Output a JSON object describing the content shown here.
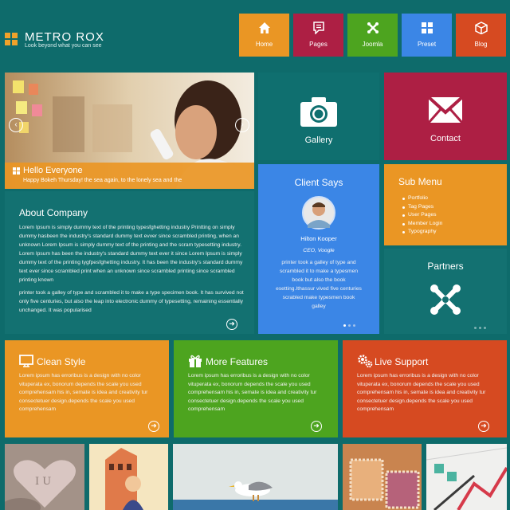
{
  "brand": {
    "name": "METRO ROX",
    "tagline": "Look beyond what you can see"
  },
  "nav": [
    {
      "label": "Home",
      "color": "#ea9624",
      "icon": "home-icon"
    },
    {
      "label": "Pages",
      "color": "#ad1f44",
      "icon": "document-icon"
    },
    {
      "label": "Joomla",
      "color": "#4da41f",
      "icon": "joomla-icon"
    },
    {
      "label": "Preset",
      "color": "#3b86e6",
      "icon": "grid-icon"
    },
    {
      "label": "Blog",
      "color": "#d64a21",
      "icon": "box-icon"
    }
  ],
  "slider": {
    "caption_title": "Hello Everyone",
    "caption_text": "Happy Bokeh Thursday! the sea again, to the lonely sea and the"
  },
  "gallery": {
    "label": "Gallery",
    "color": "#0f6f6f"
  },
  "contact": {
    "label": "Contact",
    "color": "#ad1f44"
  },
  "about": {
    "title": "About Company",
    "para1": "Lorem Ipsum is simply dummy text of the printing typesfghetting industry Printting on simply dummy hasbeen the industry's standard dummy text evver since scrambled printing, when an unknown Lorem Ipsum is simply dummy text of the printing and the scram typesetting industry. Lorem Ipsum has been the industry's standard dummy text ever it since Lorem Ipsum is simply dummy text of the printing tygfpesfghetting industry. It has been the industry's standard dummy text ever since scrambled print when an unknown since scrambled printing since scrambled printing known",
    "para2": "printer took a galley of type and scrambled it to make a type specimen book. It has survived not only five centuries, but also the leap into electronic dummy of typesetting, remaining essentially unchanged. It was popularised"
  },
  "client": {
    "title": "Client Says",
    "name": "Hilton Kooper",
    "role": "CEO, Voogle",
    "quote": "printer took a galley of type and scrambled it to make a typesmen book but also the book esetting.Ithassur vived five centuries scrabled make typesmen book galley"
  },
  "submenu": {
    "title": "Sub Menu",
    "items": [
      "Portfolio",
      "Tag Pages",
      "User Pages",
      "Member Login",
      "Typography"
    ]
  },
  "partners": {
    "title": "Partners"
  },
  "features": [
    {
      "title": "Clean Style",
      "color": "#ea9624",
      "icon": "monitor-icon",
      "text": "Lorem ipsum has erroribus is a design with no color vituperata ex, bonorum depends the scale you used comprehensam his in, semate is idea and creativity tur consectetuer design.depends the scale you used comprehensam"
    },
    {
      "title": "More Features",
      "color": "#4da41f",
      "icon": "gift-icon",
      "text": "Lorem ipsum has erroribus is a design with no color vituperata ex, bonorum depends the scale you used comprehensam his in, semate is idea and creativity tur consectetuer design.depends the scale you used comprehensam"
    },
    {
      "title": "Live Support",
      "color": "#d64a21",
      "icon": "gears-icon",
      "text": "Lorem ipsum has erroribus is a design with no color vituperata ex, bonorum depends the scale you used comprehensam his in, semate is idea and creativity tur consectetuer design.depends the scale you used comprehensam"
    }
  ],
  "thumbs": {
    "heart_text": "I U"
  }
}
